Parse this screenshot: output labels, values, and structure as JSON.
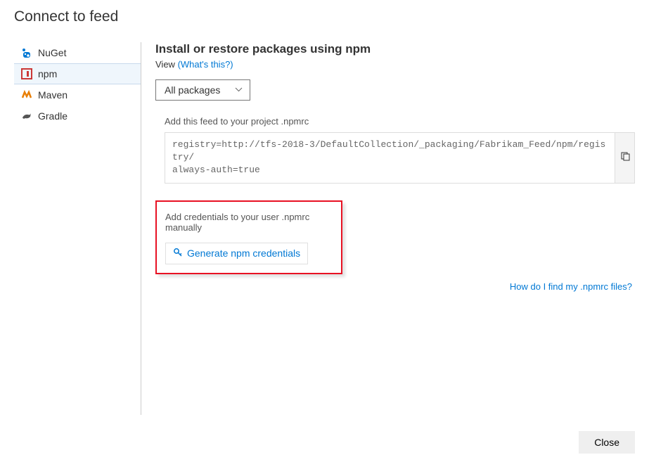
{
  "dialog": {
    "title": "Connect to feed"
  },
  "sidebar": {
    "items": [
      {
        "label": "NuGet"
      },
      {
        "label": "npm"
      },
      {
        "label": "Maven"
      },
      {
        "label": "Gradle"
      }
    ]
  },
  "content": {
    "heading": "Install or restore packages using npm",
    "view_label": "View",
    "whats_this": "(What's this?)",
    "dropdown_value": "All packages",
    "step1_text": "Add this feed to your project .npmrc",
    "code_text": "registry=http://tfs-2018-3/DefaultCollection/_packaging/Fabrikam_Feed/npm/registry/\nalways-auth=true",
    "step2_text": "Add credentials to your user .npmrc manually",
    "generate_button": "Generate npm credentials",
    "help_link": "How do I find my .npmrc files?"
  },
  "footer": {
    "close": "Close"
  }
}
